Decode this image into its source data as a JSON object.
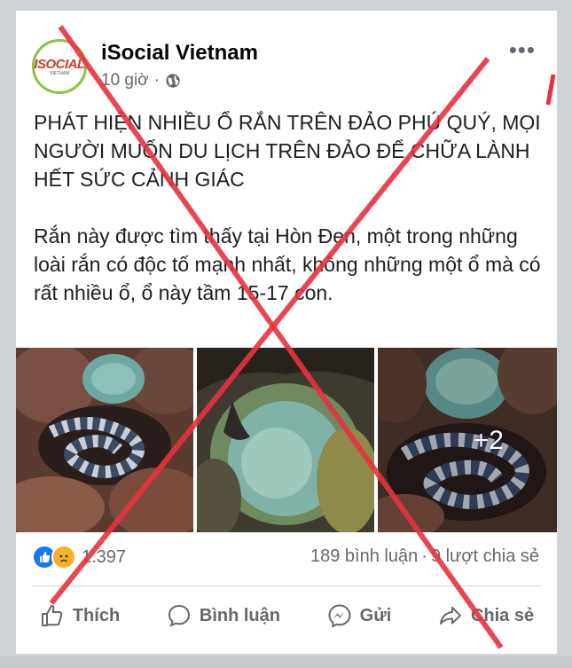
{
  "post": {
    "page_name": "iSocial Vietnam",
    "time": "10 giờ",
    "separator": "·",
    "avatar_logo": "ISOCIAL",
    "avatar_sub": "VIETNAM",
    "headline": "PHÁT HIỆN NHIỀU Ổ RẮN TRÊN ĐẢO PHÚ QUÝ, MỌI NGƯỜI MUỐN DU LỊCH TRÊN ĐẢO ĐỂ CHỮA LÀNH HẾT SỨC CẢNH GIÁC",
    "body": "Rắn này được tìm thấy tại Hòn Đen, một trong những loài rắn có độc tố mạnh nhất, không những một ổ mà có rất nhiều ổ, ổ này tầm 15-17 con.",
    "more_photos": "+2",
    "more_menu": "•••"
  },
  "engagement": {
    "reaction_count": "1.397",
    "comments": "189 bình luận",
    "stat_separator": "·",
    "shares": "9 lượt chia sẻ"
  },
  "actions": {
    "like": "Thích",
    "comment": "Bình luận",
    "send": "Gửi",
    "share": "Chia sẻ"
  },
  "colors": {
    "brand_blue": "#1877f2",
    "cross_red": "#e8323f",
    "text_gray": "#65676b"
  },
  "icons": [
    "globe-icon",
    "more-icon",
    "like-reaction-icon",
    "sad-reaction-icon",
    "thumb-up-icon",
    "comment-icon",
    "messenger-icon",
    "share-icon"
  ]
}
